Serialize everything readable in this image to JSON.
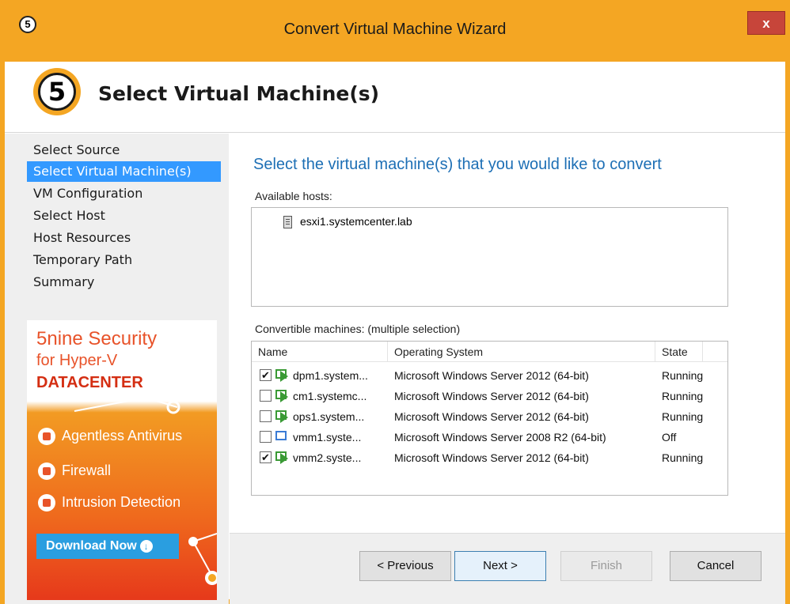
{
  "window": {
    "app_icon": "5",
    "title": "Convert Virtual Machine Wizard",
    "close_label": "x"
  },
  "header": {
    "step_number": "5",
    "title": "Select Virtual Machine(s)"
  },
  "sidebar": {
    "items": [
      {
        "label": "Select Source",
        "active": false
      },
      {
        "label": "Select Virtual Machine(s)",
        "active": true
      },
      {
        "label": "VM Configuration",
        "active": false
      },
      {
        "label": "Select Host",
        "active": false
      },
      {
        "label": "Host Resources",
        "active": false
      },
      {
        "label": "Temporary Path",
        "active": false
      },
      {
        "label": "Summary",
        "active": false
      }
    ]
  },
  "ad": {
    "title_line1": "5nine Security",
    "title_line2": "for Hyper-V",
    "title_line3": "DATACENTER",
    "features": [
      "Agentless Antivirus",
      "Firewall",
      "Intrusion Detection"
    ],
    "download_label": "Download Now"
  },
  "main": {
    "heading": "Select the virtual machine(s) that you would like to convert",
    "hosts_label": "Available hosts:",
    "hosts": [
      "esxi1.systemcenter.lab"
    ],
    "machines_label": "Convertible machines: (multiple selection)",
    "columns": {
      "name": "Name",
      "os": "Operating System",
      "state": "State"
    },
    "machines": [
      {
        "name": "dpm1.system...",
        "os": "Microsoft Windows Server 2012 (64-bit)",
        "state": "Running",
        "checked": true,
        "check_mark": "✔"
      },
      {
        "name": "cm1.systemc...",
        "os": "Microsoft Windows Server 2012 (64-bit)",
        "state": "Running",
        "checked": false,
        "check_mark": ""
      },
      {
        "name": "ops1.system...",
        "os": "Microsoft Windows Server 2012 (64-bit)",
        "state": "Running",
        "checked": false,
        "check_mark": ""
      },
      {
        "name": "vmm1.syste...",
        "os": "Microsoft Windows Server 2008 R2 (64-bit)",
        "state": "Off",
        "checked": false,
        "check_mark": ""
      },
      {
        "name": "vmm2.syste...",
        "os": "Microsoft Windows Server 2012 (64-bit)",
        "state": "Running",
        "checked": true,
        "check_mark": "✔"
      }
    ]
  },
  "footer": {
    "previous_label": "< Previous",
    "next_label": "Next >",
    "finish_label": "Finish",
    "cancel_label": "Cancel"
  },
  "colors": {
    "accent": "#f4a623",
    "selection": "#3399ff",
    "heading_blue": "#1d6fb5"
  }
}
